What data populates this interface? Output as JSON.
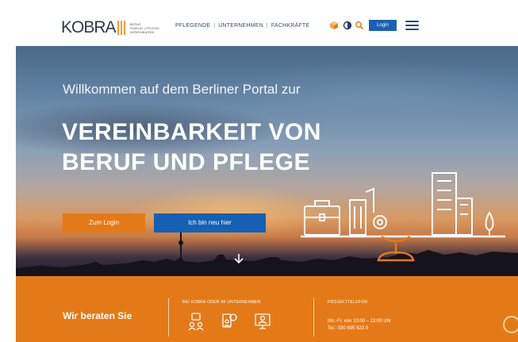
{
  "header": {
    "logo_text": "KOBRA",
    "logo_sub": [
      "BERUF",
      "FAMILIE | PFLEGE",
      "VEREINBAREN"
    ],
    "nav": [
      "PFLEGENDE",
      "UNTERNEHMEN",
      "FACHKRÄFTE"
    ],
    "nav_separator": "|",
    "login_label": "Login",
    "icons": [
      "cube-icon",
      "contrast-icon",
      "search-icon",
      "menu-icon"
    ]
  },
  "hero": {
    "welcome": "Willkommen auf dem Berliner Portal zur",
    "headline_line1": "VEREINBARKEIT VON",
    "headline_line2": "BERUF UND PFLEGE",
    "btn_primary": "Zum Login",
    "btn_secondary": "Ich bin neu hier"
  },
  "band": {
    "title": "Wir beraten Sie",
    "col1_heading": "BEI KOBRA ODER IM UNTERNEHMEN",
    "col2_heading": "PROJEKTTELEFON",
    "hours": "Mo.-Fr. von 10:00 – 13:00 Uhr",
    "phone": "Tel.: 030 695 923 0"
  },
  "colors": {
    "orange": "#e47a17",
    "blue": "#1560b3",
    "nav_text": "#3a4c6e"
  }
}
